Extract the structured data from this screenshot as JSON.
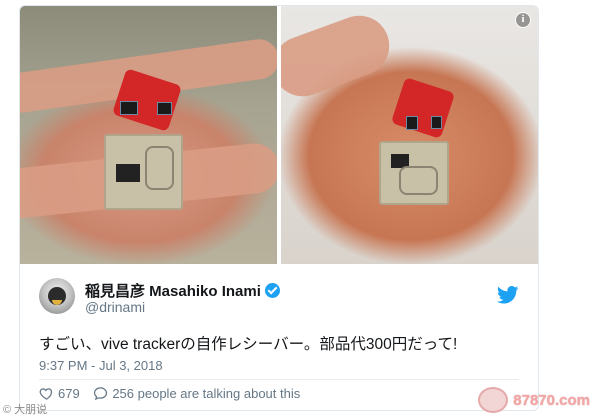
{
  "tweet": {
    "display_name": "稲見昌彦 Masahiko Inami",
    "handle": "@drinami",
    "text": "すごい、vive trackerの自作レシーバー。部品代300円だって!",
    "timestamp": "9:37 PM - Jul 3, 2018",
    "likes": "679",
    "talking": "256 people are talking about this",
    "verified": true
  },
  "icons": {
    "info": "info-icon",
    "twitter": "twitter-bird-icon",
    "like": "heart-icon",
    "reply": "speech-bubble-icon",
    "verified": "verified-badge-icon"
  },
  "colors": {
    "accent": "#1da1f2",
    "muted": "#657786",
    "text": "#14171a"
  },
  "watermarks": {
    "site": "87870.com",
    "left": "© 大朋说"
  }
}
